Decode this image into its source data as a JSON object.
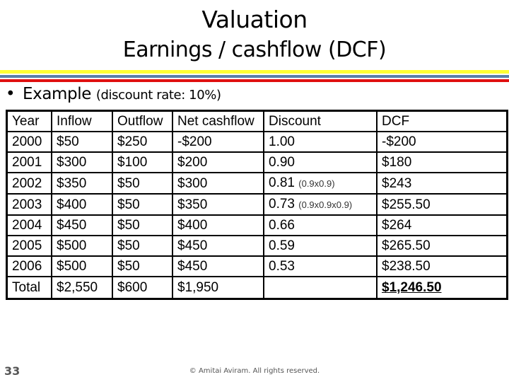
{
  "slide": {
    "title": "Valuation",
    "subtitle": "Earnings / cashflow (DCF)",
    "stripe_colors": [
      "#ffff33",
      "#5a7fa8",
      "#e01010"
    ],
    "bullet": {
      "symbol": "•",
      "text": "Example",
      "note": "(discount rate: 10%)"
    },
    "page_number": "33",
    "footer": "© Amitai Aviram.  All rights reserved."
  },
  "table": {
    "headers": [
      "Year",
      "Inflow",
      "Outflow",
      "Net cashflow",
      "Discount",
      "DCF"
    ],
    "rows": [
      {
        "year": "2000",
        "inflow": "$50",
        "outflow": "$250",
        "net": "-$200",
        "discount": "1.00",
        "discount_note": "",
        "dcf": "-$200"
      },
      {
        "year": "2001",
        "inflow": "$300",
        "outflow": "$100",
        "net": "$200",
        "discount": "0.90",
        "discount_note": "",
        "dcf": "$180"
      },
      {
        "year": "2002",
        "inflow": "$350",
        "outflow": "$50",
        "net": "$300",
        "discount": "0.81",
        "discount_note": "(0.9x0.9)",
        "dcf": "$243"
      },
      {
        "year": "2003",
        "inflow": "$400",
        "outflow": "$50",
        "net": "$350",
        "discount": "0.73",
        "discount_note": "(0.9x0.9x0.9)",
        "dcf": "$255.50"
      },
      {
        "year": "2004",
        "inflow": "$450",
        "outflow": "$50",
        "net": "$400",
        "discount": "0.66",
        "discount_note": "",
        "dcf": "$264"
      },
      {
        "year": "2005",
        "inflow": "$500",
        "outflow": "$50",
        "net": "$450",
        "discount": "0.59",
        "discount_note": "",
        "dcf": "$265.50"
      },
      {
        "year": "2006",
        "inflow": "$500",
        "outflow": "$50",
        "net": "$450",
        "discount": "0.53",
        "discount_note": "",
        "dcf": "$238.50"
      }
    ],
    "total": {
      "label": "Total",
      "inflow": "$2,550",
      "outflow": "$600",
      "net": "$1,950",
      "discount": "",
      "dcf": "$1,246.50"
    }
  }
}
